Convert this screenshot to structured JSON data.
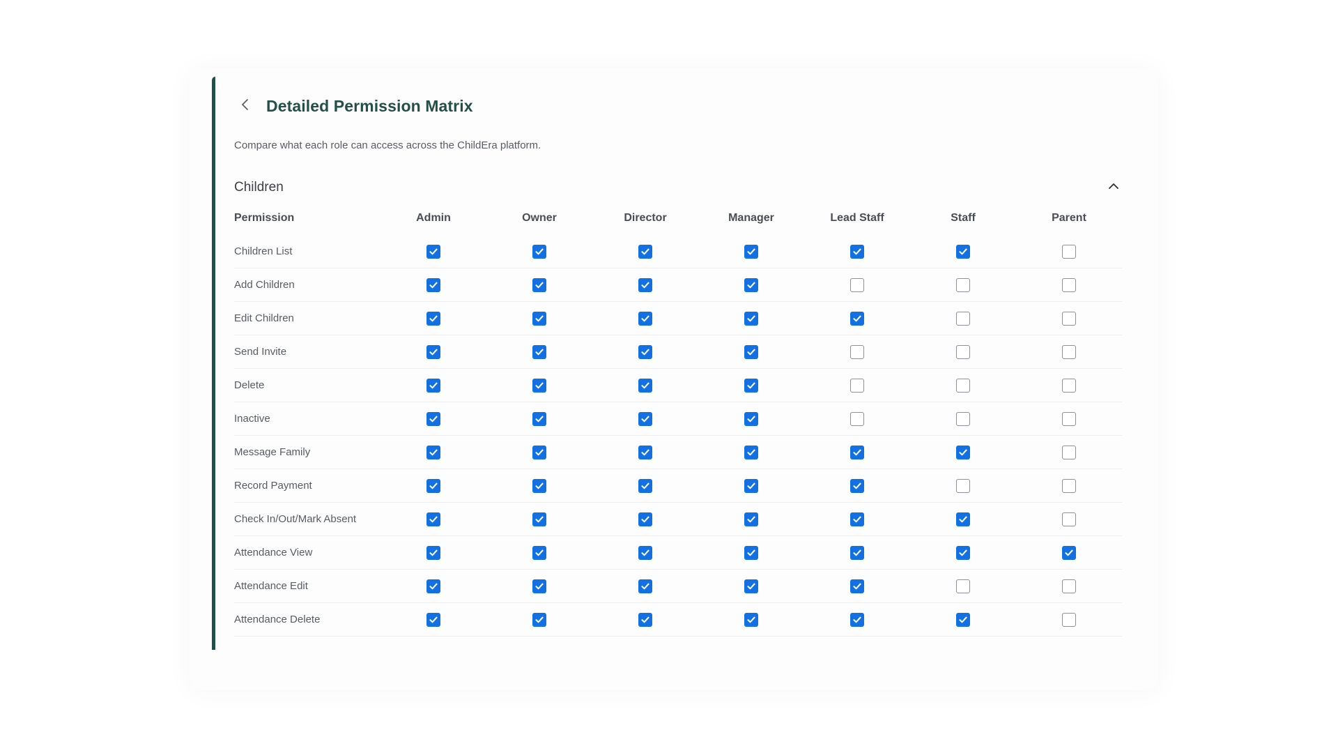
{
  "page": {
    "title": "Detailed Permission Matrix",
    "subtitle": "Compare what each role can access across the ChildEra platform.",
    "back_icon": "chevron-left-icon",
    "accent_color": "#244f48",
    "checkbox_color": "#1270e3"
  },
  "section": {
    "title": "Children",
    "collapse_icon": "chevron-up-icon",
    "expanded": true
  },
  "table": {
    "permission_header": "Permission",
    "roles": [
      "Admin",
      "Owner",
      "Director",
      "Manager",
      "Lead Staff",
      "Staff",
      "Parent"
    ],
    "rows": [
      {
        "name": "Children List",
        "checks": [
          true,
          true,
          true,
          true,
          true,
          true,
          false
        ]
      },
      {
        "name": "Add Children",
        "checks": [
          true,
          true,
          true,
          true,
          false,
          false,
          false
        ]
      },
      {
        "name": "Edit Children",
        "checks": [
          true,
          true,
          true,
          true,
          true,
          false,
          false
        ]
      },
      {
        "name": "Send Invite",
        "checks": [
          true,
          true,
          true,
          true,
          false,
          false,
          false
        ]
      },
      {
        "name": "Delete",
        "checks": [
          true,
          true,
          true,
          true,
          false,
          false,
          false
        ]
      },
      {
        "name": "Inactive",
        "checks": [
          true,
          true,
          true,
          true,
          false,
          false,
          false
        ]
      },
      {
        "name": "Message Family",
        "checks": [
          true,
          true,
          true,
          true,
          true,
          true,
          false
        ]
      },
      {
        "name": "Record Payment",
        "checks": [
          true,
          true,
          true,
          true,
          true,
          false,
          false
        ]
      },
      {
        "name": "Check In/Out/Mark Absent",
        "checks": [
          true,
          true,
          true,
          true,
          true,
          true,
          false
        ]
      },
      {
        "name": "Attendance View",
        "checks": [
          true,
          true,
          true,
          true,
          true,
          true,
          true
        ]
      },
      {
        "name": "Attendance Edit",
        "checks": [
          true,
          true,
          true,
          true,
          true,
          false,
          false
        ]
      },
      {
        "name": "Attendance Delete",
        "checks": [
          true,
          true,
          true,
          true,
          true,
          true,
          false
        ]
      }
    ]
  }
}
